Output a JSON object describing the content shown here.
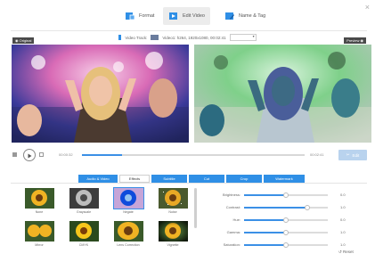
{
  "window": {
    "close_glyph": "×"
  },
  "top_tabs": [
    {
      "label": "Format",
      "icon": "format-icon",
      "active": false
    },
    {
      "label": "Edit Video",
      "icon": "edit-video-icon",
      "active": true
    },
    {
      "label": "Name & Tag",
      "icon": "name-tag-icon",
      "active": false
    }
  ],
  "video_track": {
    "label": "Video Track:",
    "value": "Video1: h264, 1920x1080, 00:02:41"
  },
  "preview": {
    "original_tag": "Original",
    "preview_tag": "Preview"
  },
  "player": {
    "current_time": "00:00:32",
    "total_time": "00:02:41",
    "progress": 0.18,
    "edit_label": "Edit"
  },
  "edit_tabs": [
    {
      "label": "Audio & Video",
      "active": false
    },
    {
      "label": "Effects",
      "active": true
    },
    {
      "label": "Subtitle",
      "active": false
    },
    {
      "label": "Cut",
      "active": false
    },
    {
      "label": "Crop",
      "active": false
    },
    {
      "label": "Watermark",
      "active": false
    }
  ],
  "effects": [
    {
      "label": "None",
      "selected": false
    },
    {
      "label": "Grayscale",
      "selected": false
    },
    {
      "label": "Negate",
      "selected": true
    },
    {
      "label": "Noise",
      "selected": false
    },
    {
      "label": "Mirror",
      "selected": false
    },
    {
      "label": "CMYK",
      "selected": false
    },
    {
      "label": "Lens Correction",
      "selected": false
    },
    {
      "label": "Vignette",
      "selected": false
    }
  ],
  "adjustments": [
    {
      "label": "Brightness:",
      "value": "0.0",
      "level": 0.5
    },
    {
      "label": "Contrast:",
      "value": "1.0",
      "level": 0.75
    },
    {
      "label": "Hue:",
      "value": "0.0",
      "level": 0.5
    },
    {
      "label": "Gamma:",
      "value": "1.0",
      "level": 0.5
    },
    {
      "label": "Saturation:",
      "value": "1.0",
      "level": 0.5
    }
  ],
  "reset_label": "Reset",
  "colors": {
    "accent": "#2f8fe6",
    "edit_button": "#b9d3ee"
  }
}
